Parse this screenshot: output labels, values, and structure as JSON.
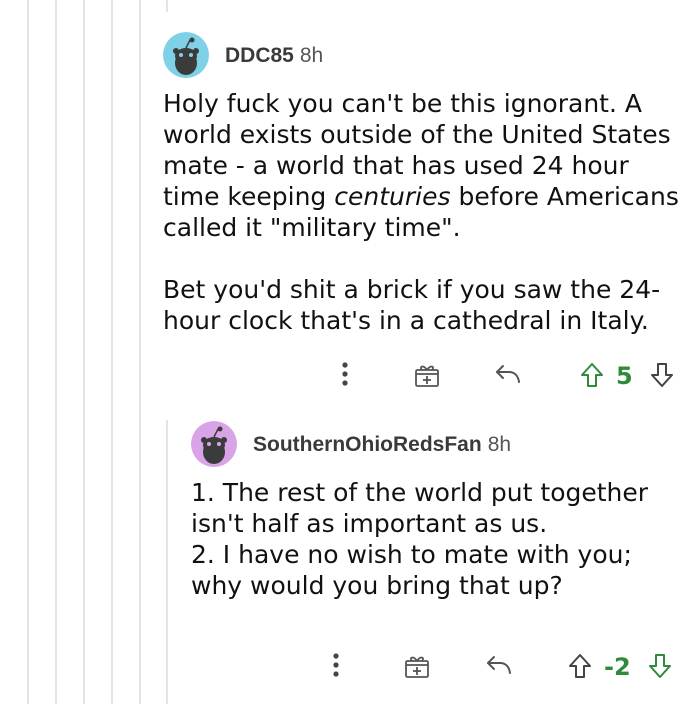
{
  "comments": [
    {
      "username": "DDC85",
      "age": "8h",
      "avatar_color": "#7fd1e8",
      "paragraph1_a": "Holy fuck you can't be this ignorant. A world exists outside of the United States mate - a world that has used 24 hour time keeping ",
      "paragraph1_em": "centuries",
      "paragraph1_b": " before Americans called it \"military time\".",
      "paragraph2": "Bet you'd shit a brick if you saw the 24-hour clock that's in a cathedral in Italy.",
      "score": "5"
    },
    {
      "username": "SouthernOhioRedsFan",
      "age": "8h",
      "avatar_color": "#d9a3e8",
      "line1": "1. The rest of the world put together isn't half as important as us.",
      "line2": "2. I have no wish to mate with you; why would you bring that up?",
      "score": "-2"
    }
  ],
  "icons": [
    "more-icon",
    "award-icon",
    "reply-icon",
    "upvote-icon",
    "downvote-icon",
    "snoo-avatar-icon"
  ],
  "colors": {
    "score": "#2e8b3a",
    "thread_line": "#e4e4e4",
    "icon": "#555555"
  }
}
